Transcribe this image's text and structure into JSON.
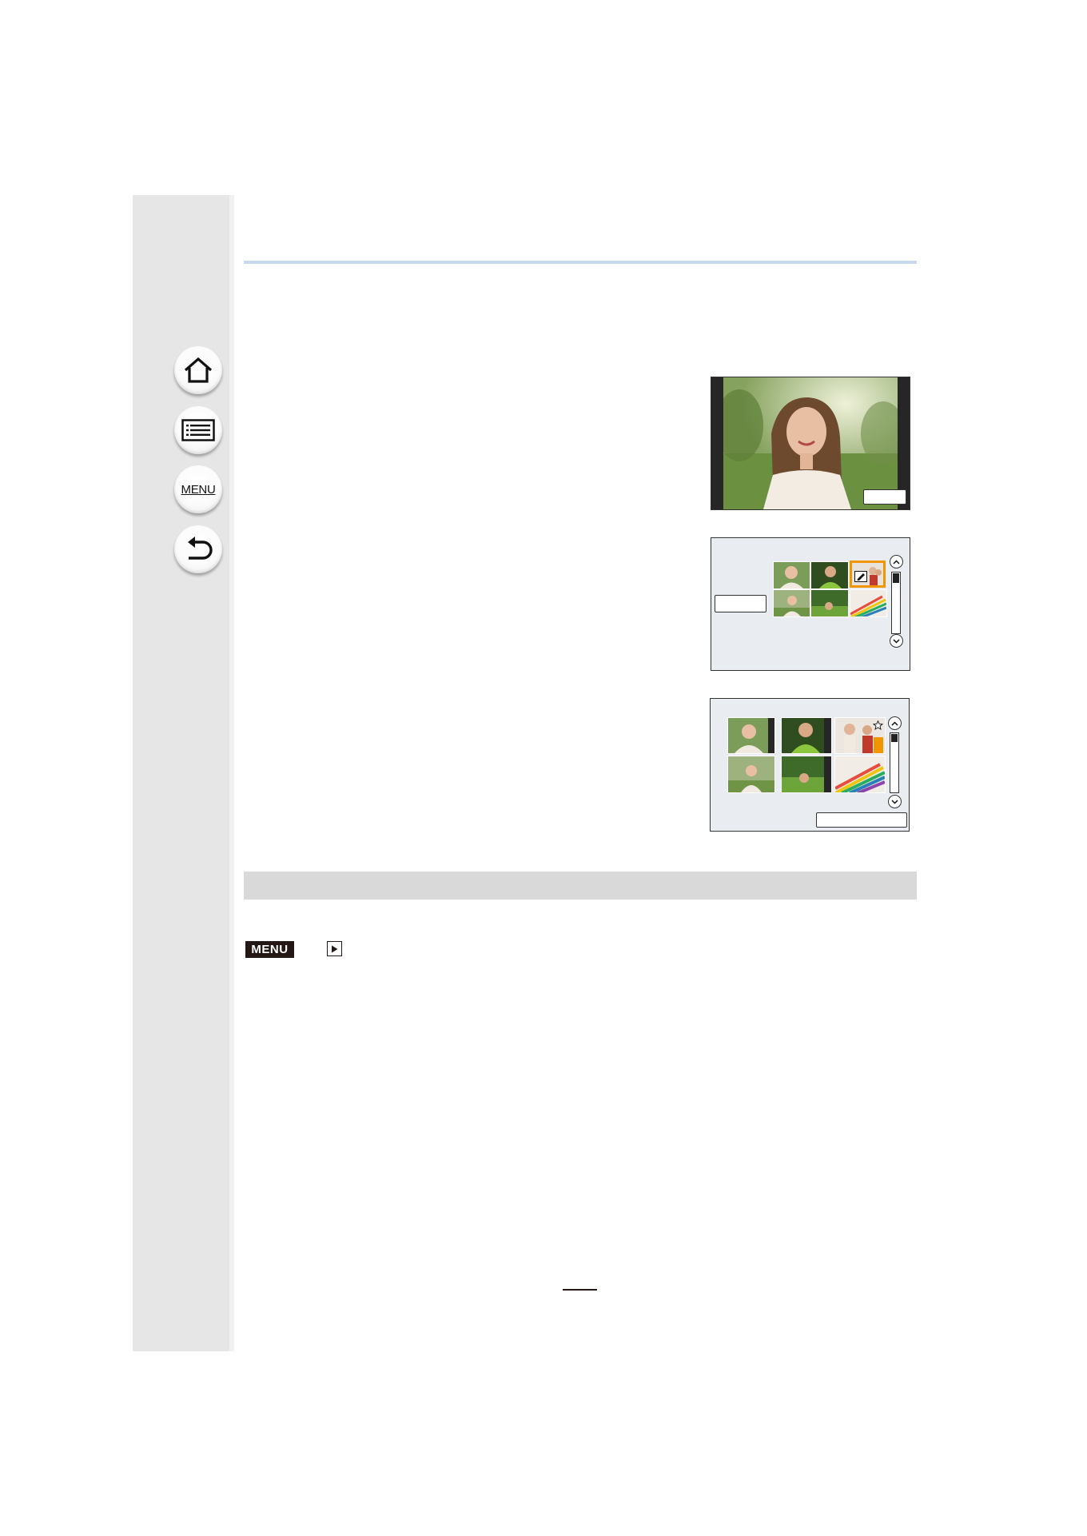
{
  "sidebar": {
    "home_icon": "home-icon",
    "contents_icon": "list-icon",
    "menu_label": "MENU",
    "back_icon": "back-arrow-icon"
  },
  "menu_path": {
    "menu_badge": "MENU",
    "playback_icon": "play-icon"
  },
  "colors": {
    "sidebar_bg": "#e6e6e6",
    "header_rule": "#c6d9ef",
    "section_band": "#d9d9d9",
    "selection_highlight": "#f29600",
    "badge_bg": "#231815"
  }
}
